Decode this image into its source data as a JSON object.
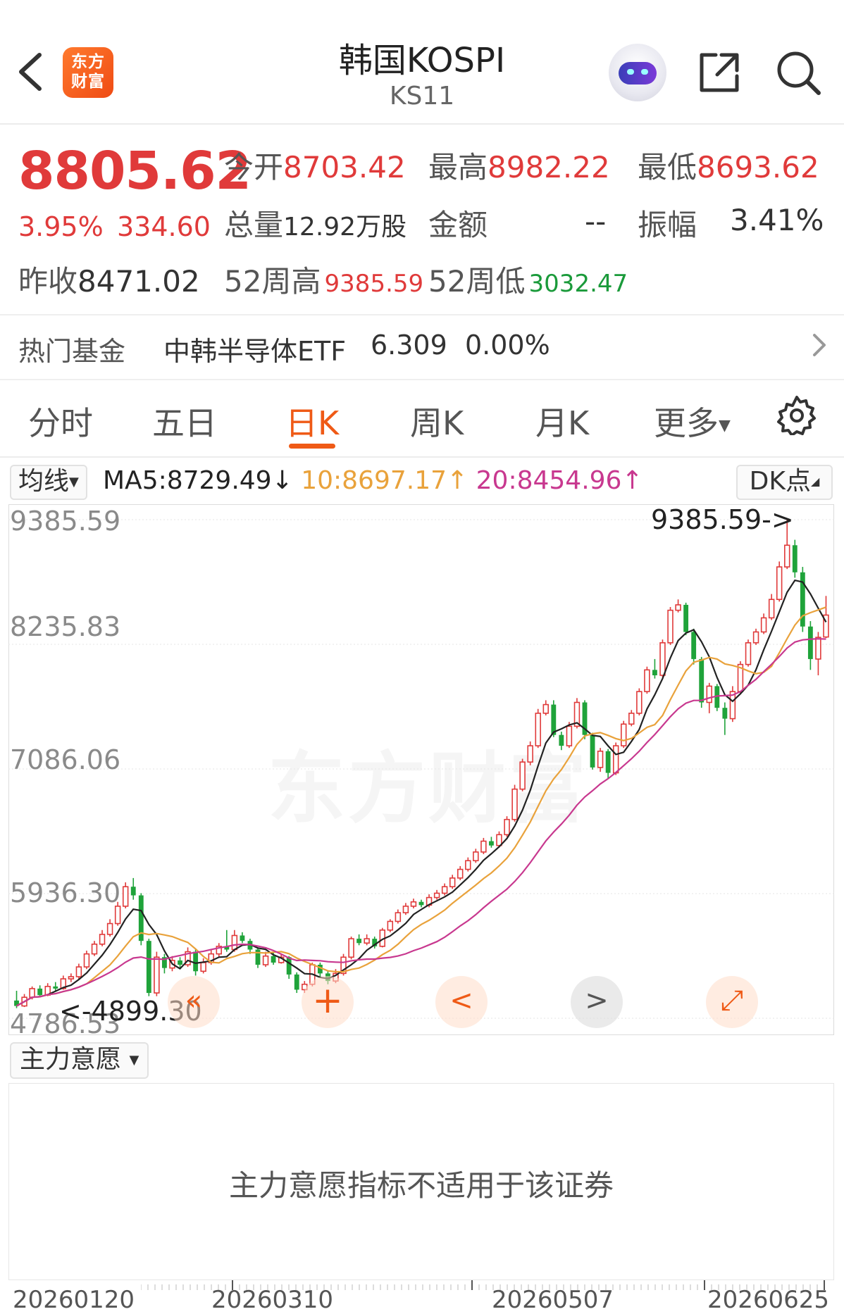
{
  "header": {
    "title": "韩国KOSPI",
    "code": "KS11",
    "logo_text_line1": "东方",
    "logo_text_line2": "财富"
  },
  "quote": {
    "price": "8805.62",
    "change_pct": "3.95%",
    "change": "334.60",
    "open_label": "今开",
    "open": "8703.42",
    "high_label": "最高",
    "high": "8982.22",
    "low_label": "最低",
    "low": "8693.62",
    "volume_label": "总量",
    "volume": "12.92万股",
    "amount_label": "金额",
    "amount": "--",
    "amplitude_label": "振幅",
    "amplitude": "3.41%",
    "prev_close_label": "昨收",
    "prev_close": "8471.02",
    "wk52_high_label": "52周高",
    "wk52_high": "9385.59",
    "wk52_low_label": "52周低",
    "wk52_low": "3032.47"
  },
  "fund": {
    "label": "热门基金",
    "name": "中韩半导体ETF",
    "price": "6.309",
    "change": "0.00%"
  },
  "tabs": [
    {
      "label": "分时"
    },
    {
      "label": "五日"
    },
    {
      "label": "日K",
      "active": true
    },
    {
      "label": "周K"
    },
    {
      "label": "月K"
    },
    {
      "label": "更多"
    }
  ],
  "indicator": {
    "select_label": "均线",
    "ma5": "MA5:8729.49",
    "ma5_dir": "↓",
    "ma10": "10:8697.17",
    "ma10_dir": "↑",
    "ma20": "20:8454.96",
    "ma20_dir": "↑",
    "dk_label": "DK点",
    "colors": {
      "ma5": "#222222",
      "ma10": "#e9a23b",
      "ma20": "#c8388f",
      "up": "#e03a3a",
      "down": "#1fa33a"
    }
  },
  "chart_data": {
    "type": "candlestick",
    "y_ticks": [
      "9385.59",
      "8235.83",
      "7086.06",
      "5936.30",
      "4786.53"
    ],
    "ylim": [
      4786.53,
      9385.59
    ],
    "annotation_high": "9385.59->",
    "annotation_low": "<-4899.30",
    "watermark": "东方财富",
    "x_ticks": [
      "20260120",
      "20260310",
      "20260507",
      "20260625"
    ],
    "candles": [
      [
        4950,
        4900,
        5040,
        4880
      ],
      [
        4900,
        4980,
        5010,
        4890
      ],
      [
        4980,
        5060,
        5080,
        4960
      ],
      [
        5060,
        5000,
        5090,
        4980
      ],
      [
        5000,
        5080,
        5110,
        4990
      ],
      [
        5080,
        5060,
        5120,
        5030
      ],
      [
        5060,
        5150,
        5180,
        5050
      ],
      [
        5150,
        5170,
        5200,
        5120
      ],
      [
        5170,
        5260,
        5290,
        5150
      ],
      [
        5260,
        5380,
        5410,
        5240
      ],
      [
        5380,
        5470,
        5500,
        5360
      ],
      [
        5470,
        5560,
        5600,
        5450
      ],
      [
        5560,
        5660,
        5700,
        5540
      ],
      [
        5660,
        5820,
        5860,
        5640
      ],
      [
        5820,
        6000,
        6040,
        5800
      ],
      [
        6000,
        5920,
        6080,
        5880
      ],
      [
        5920,
        5500,
        5940,
        5460
      ],
      [
        5500,
        5020,
        5520,
        4990
      ],
      [
        5020,
        5350,
        5400,
        4990
      ],
      [
        5350,
        5250,
        5380,
        5200
      ],
      [
        5250,
        5320,
        5360,
        5220
      ],
      [
        5320,
        5280,
        5350,
        5240
      ],
      [
        5280,
        5400,
        5440,
        5260
      ],
      [
        5400,
        5220,
        5420,
        5180
      ],
      [
        5220,
        5300,
        5340,
        5200
      ],
      [
        5300,
        5380,
        5420,
        5280
      ],
      [
        5380,
        5450,
        5480,
        5350
      ],
      [
        5450,
        5420,
        5600,
        5400
      ],
      [
        5420,
        5550,
        5600,
        5400
      ],
      [
        5550,
        5500,
        5580,
        5480
      ],
      [
        5500,
        5420,
        5520,
        5380
      ],
      [
        5420,
        5280,
        5440,
        5250
      ],
      [
        5280,
        5360,
        5400,
        5260
      ],
      [
        5360,
        5300,
        5390,
        5280
      ],
      [
        5300,
        5350,
        5380,
        5290
      ],
      [
        5350,
        5190,
        5360,
        5150
      ],
      [
        5190,
        5050,
        5210,
        5020
      ],
      [
        5050,
        5100,
        5130,
        5020
      ],
      [
        5100,
        5280,
        5300,
        5080
      ],
      [
        5280,
        5200,
        5300,
        5160
      ],
      [
        5200,
        5130,
        5220,
        5100
      ],
      [
        5130,
        5200,
        5240,
        5110
      ],
      [
        5200,
        5350,
        5380,
        5180
      ],
      [
        5350,
        5520,
        5540,
        5330
      ],
      [
        5520,
        5480,
        5560,
        5460
      ],
      [
        5480,
        5520,
        5560,
        5460
      ],
      [
        5520,
        5450,
        5540,
        5430
      ],
      [
        5450,
        5600,
        5620,
        5440
      ],
      [
        5600,
        5680,
        5700,
        5580
      ],
      [
        5680,
        5760,
        5790,
        5660
      ],
      [
        5760,
        5820,
        5850,
        5740
      ],
      [
        5820,
        5860,
        5890,
        5800
      ],
      [
        5860,
        5830,
        5880,
        5810
      ],
      [
        5830,
        5900,
        5930,
        5810
      ],
      [
        5900,
        5940,
        5970,
        5880
      ],
      [
        5940,
        6000,
        6030,
        5920
      ],
      [
        6000,
        6080,
        6110,
        5980
      ],
      [
        6080,
        6160,
        6190,
        6060
      ],
      [
        6160,
        6240,
        6270,
        6140
      ],
      [
        6240,
        6320,
        6350,
        6220
      ],
      [
        6320,
        6420,
        6450,
        6300
      ],
      [
        6420,
        6380,
        6460,
        6360
      ],
      [
        6380,
        6480,
        6510,
        6360
      ],
      [
        6480,
        6620,
        6650,
        6460
      ],
      [
        6620,
        6900,
        6940,
        6600
      ],
      [
        6900,
        7150,
        7180,
        6880
      ],
      [
        7150,
        7300,
        7340,
        7120
      ],
      [
        7300,
        7600,
        7640,
        7280
      ],
      [
        7600,
        7680,
        7720,
        7580
      ],
      [
        7680,
        7400,
        7720,
        7380
      ],
      [
        7400,
        7300,
        7430,
        7260
      ],
      [
        7300,
        7480,
        7520,
        7280
      ],
      [
        7480,
        7700,
        7740,
        7460
      ],
      [
        7700,
        7400,
        7720,
        7360
      ],
      [
        7400,
        7100,
        7420,
        7080
      ],
      [
        7100,
        7250,
        7280,
        7060
      ],
      [
        7250,
        7050,
        7270,
        7000
      ],
      [
        7050,
        7300,
        7330,
        7030
      ],
      [
        7300,
        7500,
        7530,
        7280
      ],
      [
        7500,
        7600,
        7630,
        7480
      ],
      [
        7600,
        7800,
        7830,
        7580
      ],
      [
        7800,
        8000,
        8030,
        7780
      ],
      [
        8000,
        7950,
        8100,
        7920
      ],
      [
        7950,
        8250,
        8280,
        7930
      ],
      [
        8250,
        8550,
        8580,
        8230
      ],
      [
        8550,
        8600,
        8650,
        8530
      ],
      [
        8600,
        8350,
        8620,
        8320
      ],
      [
        8350,
        8100,
        8380,
        8050
      ],
      [
        8100,
        7700,
        8120,
        7650
      ],
      [
        7700,
        7850,
        7880,
        7600
      ],
      [
        7850,
        7650,
        7870,
        7620
      ],
      [
        7650,
        7550,
        7700,
        7400
      ],
      [
        7550,
        7800,
        7850,
        7520
      ],
      [
        7800,
        8050,
        8080,
        7780
      ],
      [
        8050,
        8250,
        8280,
        8030
      ],
      [
        8250,
        8350,
        8380,
        8230
      ],
      [
        8350,
        8480,
        8520,
        8330
      ],
      [
        8480,
        8650,
        8700,
        8460
      ],
      [
        8650,
        8950,
        9000,
        8630
      ],
      [
        8950,
        9150,
        9385.59,
        8930
      ],
      [
        9150,
        8900,
        9200,
        8850
      ],
      [
        8900,
        8400,
        8950,
        8350
      ],
      [
        8400,
        8100,
        8450,
        8000
      ],
      [
        8100,
        8300,
        8350,
        7950
      ],
      [
        8303.42,
        8505.62,
        8682.22,
        8293.62
      ]
    ],
    "ma5_last": 8729.49,
    "ma10_last": 8697.17,
    "ma20_last": 8454.96
  },
  "controls": [
    "«",
    "+",
    "<",
    ">",
    "⤢"
  ],
  "sub_panel": {
    "select_label": "主力意愿",
    "message": "主力意愿指标不适用于该证券"
  },
  "x_axis_dates": [
    "20260120",
    "20260310",
    "20260507",
    "20260625"
  ]
}
